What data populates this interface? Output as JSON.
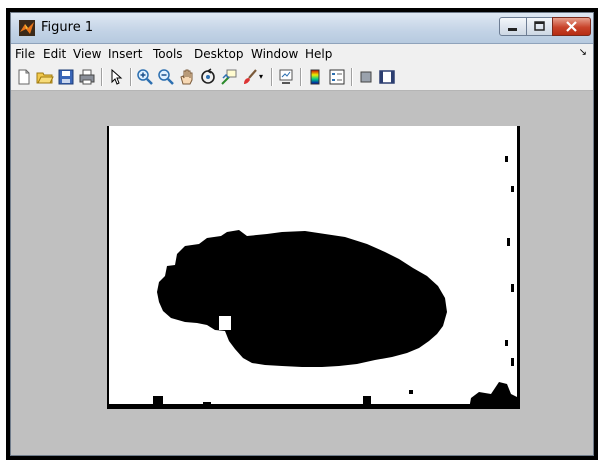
{
  "window": {
    "title": "Figure 1"
  },
  "menu": {
    "items": [
      "File",
      "Edit",
      "View",
      "Insert",
      "Tools",
      "Desktop",
      "Window",
      "Help"
    ]
  },
  "toolbar": {
    "icons": [
      "new-figure-icon",
      "open-file-icon",
      "save-icon",
      "print-icon",
      "pointer-icon",
      "zoom-in-icon",
      "zoom-out-icon",
      "pan-hand-icon",
      "rotate-3d-icon",
      "data-cursor-icon",
      "brush-icon",
      "link-plot-icon",
      "colorbar-icon",
      "legend-icon",
      "hide-plot-tools-icon",
      "show-plot-tools-icon"
    ]
  },
  "colors": {
    "figure_bg": "#c0c0c0",
    "image_fg": "#000000",
    "image_bg": "#ffffff",
    "close_red": "#c8432a"
  }
}
